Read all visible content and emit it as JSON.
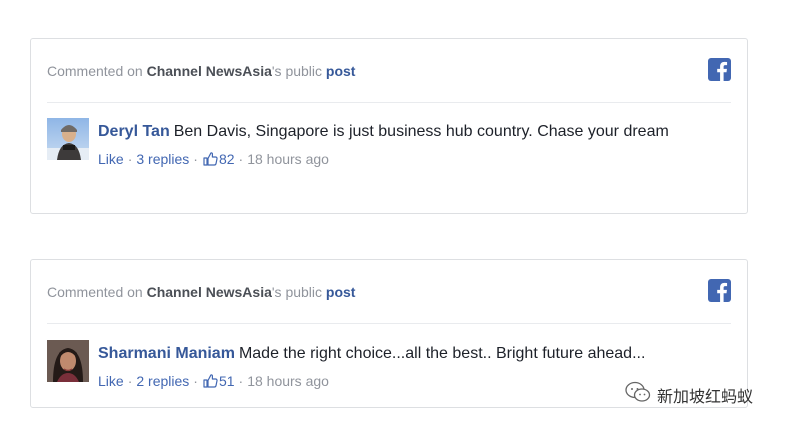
{
  "posts": [
    {
      "header": {
        "prefix": "Commented on ",
        "page": "Channel NewsAsia",
        "possessive": "'s public ",
        "post_link": "post"
      },
      "comment": {
        "author": "Deryl Tan",
        "text": "Ben Davis, Singapore is just business hub country. Chase your dream",
        "like_label": "Like",
        "replies_label": "3 replies",
        "like_count": "82",
        "time": "18 hours ago"
      }
    },
    {
      "header": {
        "prefix": "Commented on ",
        "page": "Channel NewsAsia",
        "possessive": "'s public ",
        "post_link": "post"
      },
      "comment": {
        "author": "Sharmani Maniam",
        "text": "Made the right choice...all the best.. Bright future ahead...",
        "like_label": "Like",
        "replies_label": "2 replies",
        "like_count": "51",
        "time": "18 hours ago"
      }
    }
  ],
  "watermark": {
    "text": "新加坡红蚂蚁"
  },
  "colors": {
    "link_blue": "#365899",
    "facebook_blue": "#4267b2",
    "meta_gray": "#90949c",
    "border": "#dddfe2"
  },
  "icons": [
    "facebook-icon",
    "thumbs-up-icon",
    "wechat-icon"
  ]
}
